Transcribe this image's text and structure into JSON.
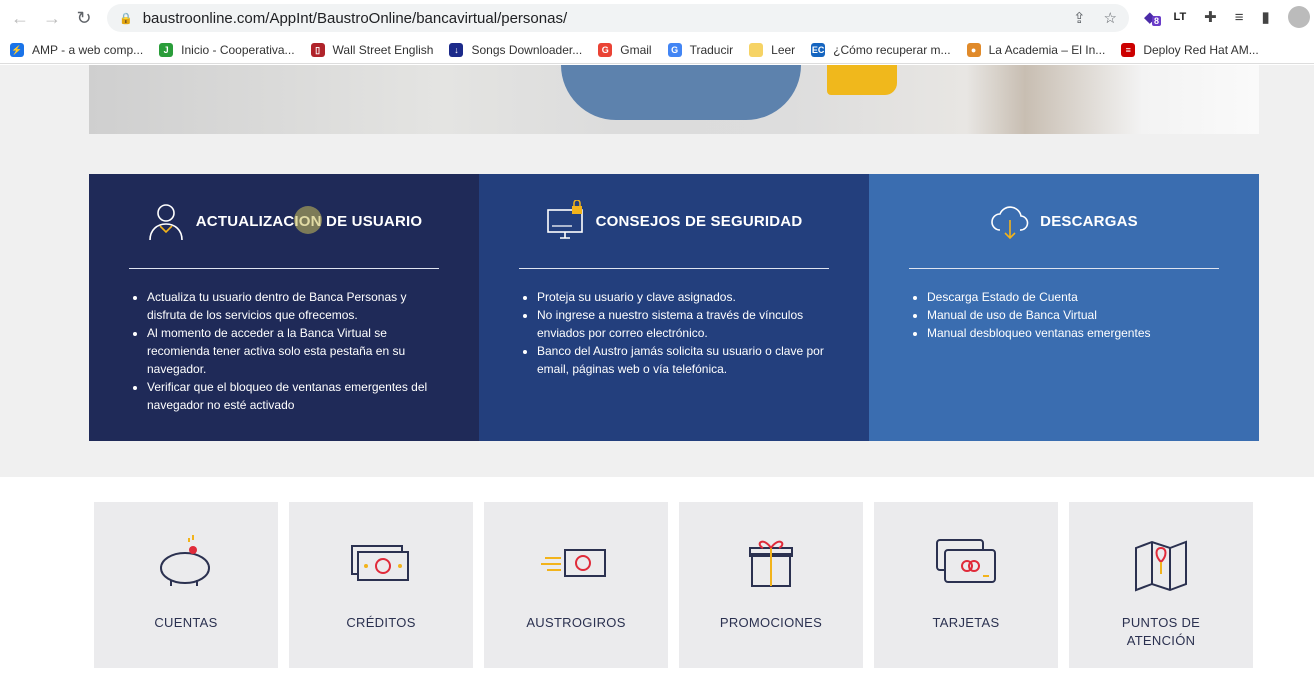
{
  "browser": {
    "url": "baustroonline.com/AppInt/BaustroOnline/bancavirtual/personas/",
    "ext_badge": "8",
    "ext_lt": "LT"
  },
  "bookmarks": [
    {
      "label": "AMP - a web comp...",
      "color": "#1a73e8",
      "glyph": "⚡"
    },
    {
      "label": "Inicio - Cooperativa...",
      "color": "#2a9d3a",
      "glyph": "J"
    },
    {
      "label": "Wall Street English",
      "color": "#b0232a",
      "glyph": "▯"
    },
    {
      "label": "Songs Downloader...",
      "color": "#1c2a8a",
      "glyph": "↓"
    },
    {
      "label": "Gmail",
      "color": "#ea4335",
      "glyph": "G"
    },
    {
      "label": "Traducir",
      "color": "#4285f4",
      "glyph": "G"
    },
    {
      "label": "Leer",
      "color": "#f6d365",
      "glyph": ""
    },
    {
      "label": "¿Cómo recuperar m...",
      "color": "#1565c0",
      "glyph": "EC"
    },
    {
      "label": "La Academia – El In...",
      "color": "#e08a2a",
      "glyph": "●"
    },
    {
      "label": "Deploy Red Hat AM...",
      "color": "#cc0000",
      "glyph": "≡"
    }
  ],
  "panels": [
    {
      "title": "ACTUALIZACION DE USUARIO",
      "icon": "user-icon",
      "items": [
        "Actualiza tu usuario dentro de Banca Personas y disfruta de los servicios que ofrecemos.",
        "Al momento de acceder a la Banca Virtual se recomienda tener activa solo esta pestaña en su navegador.",
        "Verificar que el bloqueo de ventanas emergentes del  navegador no esté activado"
      ]
    },
    {
      "title": "CONSEJOS DE SEGURIDAD",
      "icon": "secure-monitor-icon",
      "items": [
        "Proteja su usuario y clave asignados.",
        "No ingrese a nuestro sistema a través de vínculos enviados por correo electrónico.",
        "Banco del Austro jamás solicita su usuario o clave por email, páginas web o vía telefónica."
      ]
    },
    {
      "title": "DESCARGAS",
      "icon": "cloud-download-icon",
      "items": [
        "Descarga Estado de Cuenta",
        "Manual de uso de Banca Virtual",
        "Manual desbloqueo ventanas emergentes"
      ]
    }
  ],
  "tiles": [
    "CUENTAS",
    "CRÉDITOS",
    "AUSTROGIROS",
    "PROMOCIONES",
    "TARJETAS",
    "PUNTOS DE ATENCIÓN"
  ],
  "colors": {
    "panel1": "#1f2a58",
    "panel2": "#233f7d",
    "panel3": "#3a6db0",
    "accent": "#f2b31b",
    "red": "#e02b3a"
  }
}
